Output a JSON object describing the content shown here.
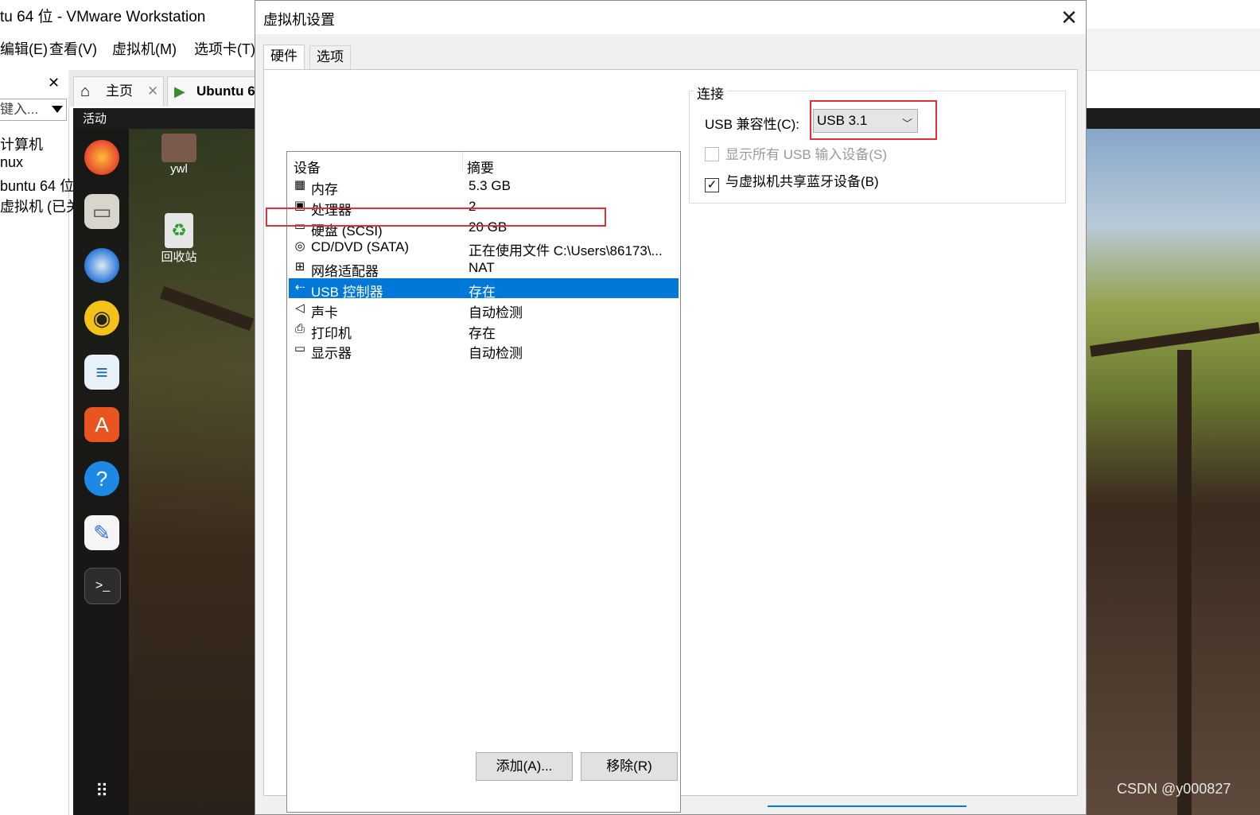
{
  "vmware": {
    "title": "tu 64 位 - VMware Workstation",
    "menu": [
      "编辑(E)",
      "查看(V)",
      "虚拟机(M)",
      "选项卡(T)"
    ],
    "library": {
      "close": "✕",
      "search_placeholder": "键入...",
      "items": [
        "计算机",
        "nux",
        "buntu 64 位",
        "虚拟机 (已关"
      ]
    },
    "tabs": [
      {
        "label": "主页",
        "close": "✕"
      },
      {
        "label": "Ubuntu 6"
      }
    ],
    "guest": {
      "activities": "活动",
      "desktop_icons": [
        {
          "label": "ywl",
          "icon": "home-folder-icon"
        },
        {
          "label": "回收站",
          "icon": "trash-icon"
        }
      ],
      "dock_icons": [
        "firefox-icon",
        "files-icon",
        "thunderbird-icon",
        "rhythmbox-icon",
        "writer-icon",
        "software-icon",
        "help-icon",
        "text-editor-icon",
        "terminal-icon",
        "app-grid-icon"
      ]
    },
    "watermark": "CSDN @y000827"
  },
  "dialog": {
    "title": "虚拟机设置",
    "tabs": [
      {
        "label": "硬件",
        "active": true
      },
      {
        "label": "选项",
        "active": false
      }
    ],
    "device_list": {
      "headers": {
        "device": "设备",
        "summary": "摘要"
      },
      "rows": [
        {
          "name": "内存",
          "summary": "5.3 GB",
          "icon": "memory-icon",
          "glyph": "▦"
        },
        {
          "name": "处理器",
          "summary": "2",
          "icon": "processor-icon",
          "glyph": "▣"
        },
        {
          "name": "硬盘 (SCSI)",
          "summary": "20 GB",
          "icon": "hard-disk-icon",
          "glyph": "▭"
        },
        {
          "name": "CD/DVD (SATA)",
          "summary": "正在使用文件 C:\\Users\\86173\\...",
          "icon": "cd-dvd-icon",
          "glyph": "◎"
        },
        {
          "name": "网络适配器",
          "summary": "NAT",
          "icon": "network-adapter-icon",
          "glyph": "⊞"
        },
        {
          "name": "USB 控制器",
          "summary": "存在",
          "icon": "usb-icon",
          "glyph": "⇠",
          "selected": true
        },
        {
          "name": "声卡",
          "summary": "自动检测",
          "icon": "sound-card-icon",
          "glyph": "◁"
        },
        {
          "name": "打印机",
          "summary": "存在",
          "icon": "printer-icon",
          "glyph": "⎙"
        },
        {
          "name": "显示器",
          "summary": "自动检测",
          "icon": "display-icon",
          "glyph": "▭"
        }
      ]
    },
    "buttons": {
      "add": "添加(A)...",
      "remove": "移除(R)"
    },
    "connection": {
      "group_label": "连接",
      "usb_compat_label": "USB 兼容性(C):",
      "usb_compat_value": "USB 3.1",
      "show_all_usb_input": {
        "label": "显示所有 USB 输入设备(S)",
        "checked": false,
        "enabled": false
      },
      "share_bluetooth": {
        "label": "与虚拟机共享蓝牙设备(B)",
        "checked": true,
        "enabled": true
      }
    },
    "close": "✕"
  },
  "colors": {
    "selection": "#0078d7",
    "highlight_box": "#e0303a"
  }
}
